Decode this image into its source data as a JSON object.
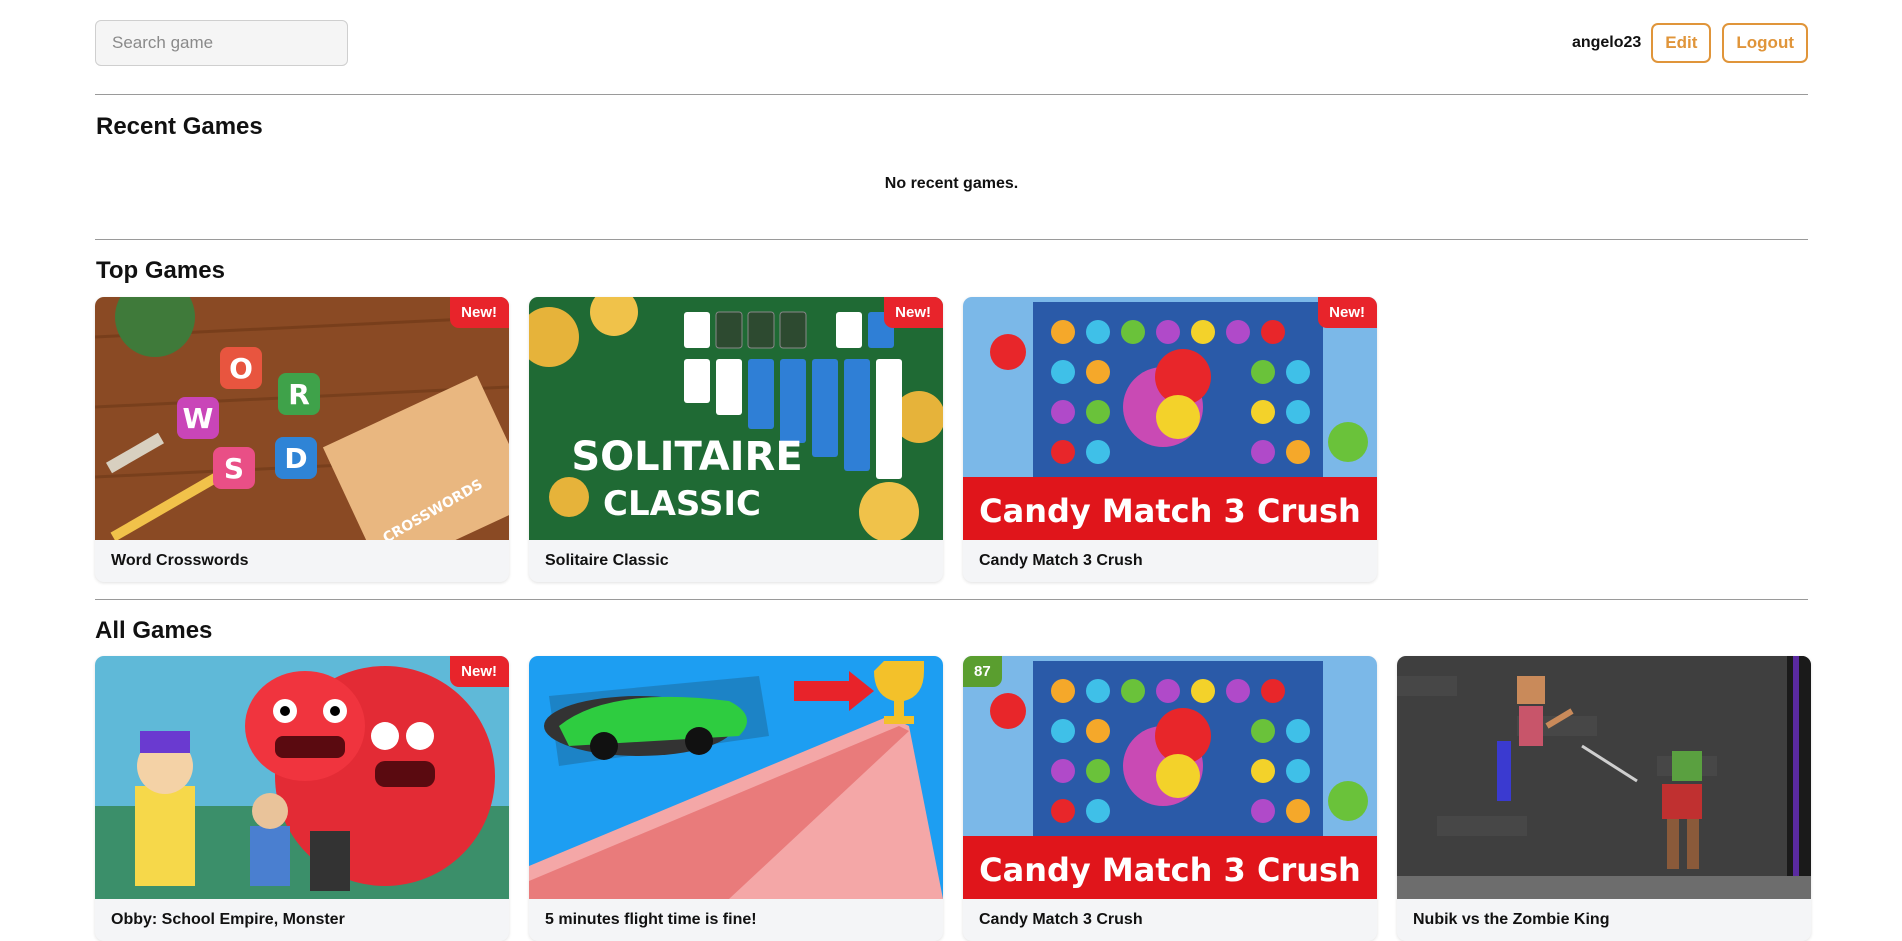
{
  "search": {
    "placeholder": "Search game"
  },
  "user": {
    "username": "angelo23",
    "edit_label": "Edit",
    "logout_label": "Logout"
  },
  "recent": {
    "title": "Recent Games",
    "empty_message": "No recent games."
  },
  "top": {
    "title": "Top Games",
    "games": [
      {
        "name": "Word Crosswords",
        "badge": "New!",
        "thumb_icon": "word-crosswords-thumbnail",
        "thumb_text": [
          "W",
          "O",
          "R",
          "D",
          "S",
          "CROSSWORDS"
        ]
      },
      {
        "name": "Solitaire Classic",
        "badge": "New!",
        "thumb_icon": "solitaire-classic-thumbnail",
        "thumb_text": [
          "SOLITAIRE",
          "CLASSIC"
        ]
      },
      {
        "name": "Candy Match 3 Crush",
        "badge": "New!",
        "thumb_icon": "candy-match-thumbnail",
        "thumb_text": [
          "Candy Match 3 Crush"
        ]
      }
    ]
  },
  "all": {
    "title": "All Games",
    "games": [
      {
        "name": "Obby: School Empire, Monster",
        "badge": "New!",
        "thumb_icon": "obby-monster-thumbnail"
      },
      {
        "name": "5 minutes flight time is fine!",
        "badge": "",
        "thumb_icon": "car-flight-thumbnail"
      },
      {
        "name": "Candy Match 3 Crush",
        "score": "87",
        "thumb_icon": "candy-match-thumbnail",
        "thumb_text": [
          "Candy Match 3 Crush"
        ]
      },
      {
        "name": "Nubik vs the Zombie King",
        "badge": "",
        "thumb_icon": "nubik-zombie-thumbnail"
      }
    ]
  },
  "colors": {
    "accent": "#e0953a",
    "badge_new": "#e8242b",
    "badge_score": "#5a9e2f",
    "candy_banner": "#e0151b"
  }
}
